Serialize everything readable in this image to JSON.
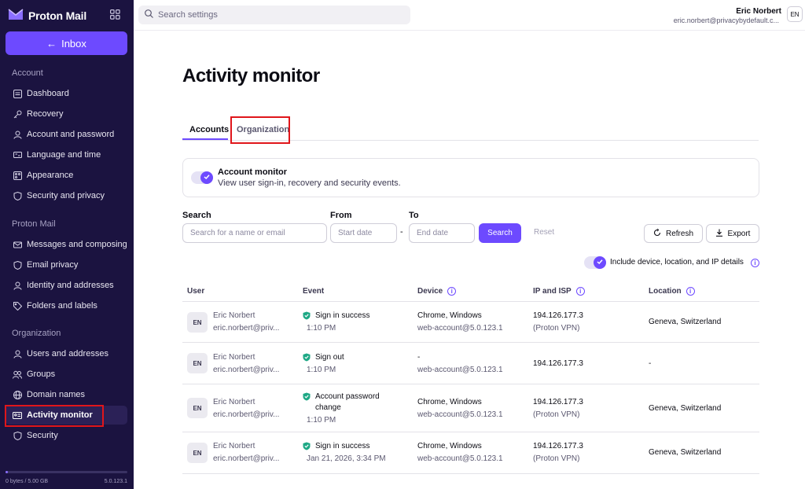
{
  "sidebar": {
    "brand": "Proton Mail",
    "inbox_label": "Inbox",
    "sections": {
      "account": "Account",
      "protonmail": "Proton Mail",
      "organization": "Organization"
    },
    "items": [
      {
        "label": "Dashboard",
        "icon": "dashboard-icon"
      },
      {
        "label": "Recovery",
        "icon": "key-icon"
      },
      {
        "label": "Account and password",
        "icon": "user-icon"
      },
      {
        "label": "Language and time",
        "icon": "language-icon"
      },
      {
        "label": "Appearance",
        "icon": "palette-icon"
      },
      {
        "label": "Security and privacy",
        "icon": "shield-icon"
      },
      {
        "label": "Messages and composing",
        "icon": "envelope-icon"
      },
      {
        "label": "Email privacy",
        "icon": "shield-icon"
      },
      {
        "label": "Identity and addresses",
        "icon": "user-icon"
      },
      {
        "label": "Folders and labels",
        "icon": "tag-icon"
      },
      {
        "label": "Users and addresses",
        "icon": "user-icon"
      },
      {
        "label": "Groups",
        "icon": "users-icon"
      },
      {
        "label": "Domain names",
        "icon": "globe-icon"
      },
      {
        "label": "Activity monitor",
        "icon": "id-card-icon"
      },
      {
        "label": "Security",
        "icon": "shield-icon"
      }
    ],
    "storage": "0 bytes / 5.00 GB",
    "storage_used_fraction": 0.0,
    "version": "5.0.123.1"
  },
  "topbar": {
    "search_placeholder": "Search settings",
    "user_name": "Eric Norbert",
    "user_email": "eric.norbert@privacybydefault.c...",
    "language": "EN"
  },
  "main": {
    "title": "Activity monitor",
    "tabs": [
      "Accounts",
      "Organization"
    ],
    "monitor": {
      "title": "Account monitor",
      "description": "View user sign-in, recovery and security events."
    },
    "filters": {
      "search_label": "Search",
      "search_placeholder": "Search for a name or email",
      "from_label": "From",
      "from_placeholder": "Start date",
      "dash": "-",
      "to_label": "To",
      "to_placeholder": "End date",
      "search_button": "Search",
      "reset_button": "Reset",
      "refresh_button": "Refresh",
      "export_button": "Export",
      "include_details": "Include device, location, and IP details"
    },
    "table": {
      "headers": [
        "User",
        "Event",
        "Device",
        "IP and ISP",
        "Location"
      ],
      "rows": [
        {
          "avatar": "EN",
          "name": "Eric Norbert",
          "email": "eric.norbert@priv...",
          "event_line1": "Sign in success",
          "event_line2": "",
          "time": "1:10 PM",
          "device": "Chrome, Windows",
          "app": "web-account@5.0.123.1",
          "ip": "194.126.177.3",
          "isp": "(Proton VPN)",
          "location": "Geneva, Switzerland"
        },
        {
          "avatar": "EN",
          "name": "Eric Norbert",
          "email": "eric.norbert@priv...",
          "event_line1": "Sign out",
          "event_line2": "",
          "time": "1:10 PM",
          "device": "-",
          "app": "web-account@5.0.123.1",
          "ip": "194.126.177.3",
          "isp": "",
          "location": "-"
        },
        {
          "avatar": "EN",
          "name": "Eric Norbert",
          "email": "eric.norbert@priv...",
          "event_line1": "Account password",
          "event_line2": "change",
          "time": "1:10 PM",
          "device": "Chrome, Windows",
          "app": "web-account@5.0.123.1",
          "ip": "194.126.177.3",
          "isp": "(Proton VPN)",
          "location": "Geneva, Switzerland"
        },
        {
          "avatar": "EN",
          "name": "Eric Norbert",
          "email": "eric.norbert@priv...",
          "event_line1": "Sign in success",
          "event_line2": "",
          "time": "Jan 21, 2026, 3:34 PM",
          "device": "Chrome, Windows",
          "app": "web-account@5.0.123.1",
          "ip": "194.126.177.3",
          "isp": "(Proton VPN)",
          "location": "Geneva, Switzerland"
        }
      ]
    }
  },
  "colors": {
    "sidebar_bg": "#1b1340",
    "accent": "#6d4aff",
    "success": "#1ea885",
    "highlight": "#e0161b"
  }
}
